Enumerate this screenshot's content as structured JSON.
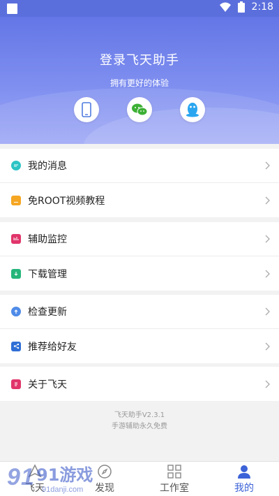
{
  "status_bar": {
    "time": "2:18"
  },
  "header": {
    "title": "登录飞天助手",
    "subtitle": "拥有更好的体验",
    "login_options": [
      "phone-icon",
      "wechat-icon",
      "qq-icon"
    ]
  },
  "menu": {
    "group1": [
      {
        "label": "我的消息",
        "icon": "message-icon",
        "color": "#2ec4c4"
      },
      {
        "label": "免ROOT视频教程",
        "icon": "video-tutorial-icon",
        "color": "#f5a623"
      }
    ],
    "group2": [
      {
        "label": "辅助监控",
        "icon": "monitor-icon",
        "color": "#e0356b"
      },
      {
        "label": "下载管理",
        "icon": "download-icon",
        "color": "#26b57a"
      }
    ],
    "group3": [
      {
        "label": "检查更新",
        "icon": "update-icon",
        "color": "#4f8be8"
      },
      {
        "label": "推荐给好友",
        "icon": "share-icon",
        "color": "#2f6fd6"
      }
    ],
    "group4": [
      {
        "label": "关于飞天",
        "icon": "about-icon",
        "color": "#e0356b"
      }
    ]
  },
  "footer": {
    "version": "飞天助手V2.3.1",
    "tagline": "手游辅助永久免费"
  },
  "bottom_nav": {
    "items": [
      {
        "label": "飞天",
        "icon": "home-icon"
      },
      {
        "label": "发现",
        "icon": "compass-icon"
      },
      {
        "label": "工作室",
        "icon": "grid-icon"
      },
      {
        "label": "我的",
        "icon": "profile-icon"
      }
    ],
    "active_index": 3
  },
  "watermark": {
    "brand": "91游戏",
    "url": "91danji.com"
  },
  "colors": {
    "accent": "#3d63d8",
    "header": "#6476e6"
  }
}
